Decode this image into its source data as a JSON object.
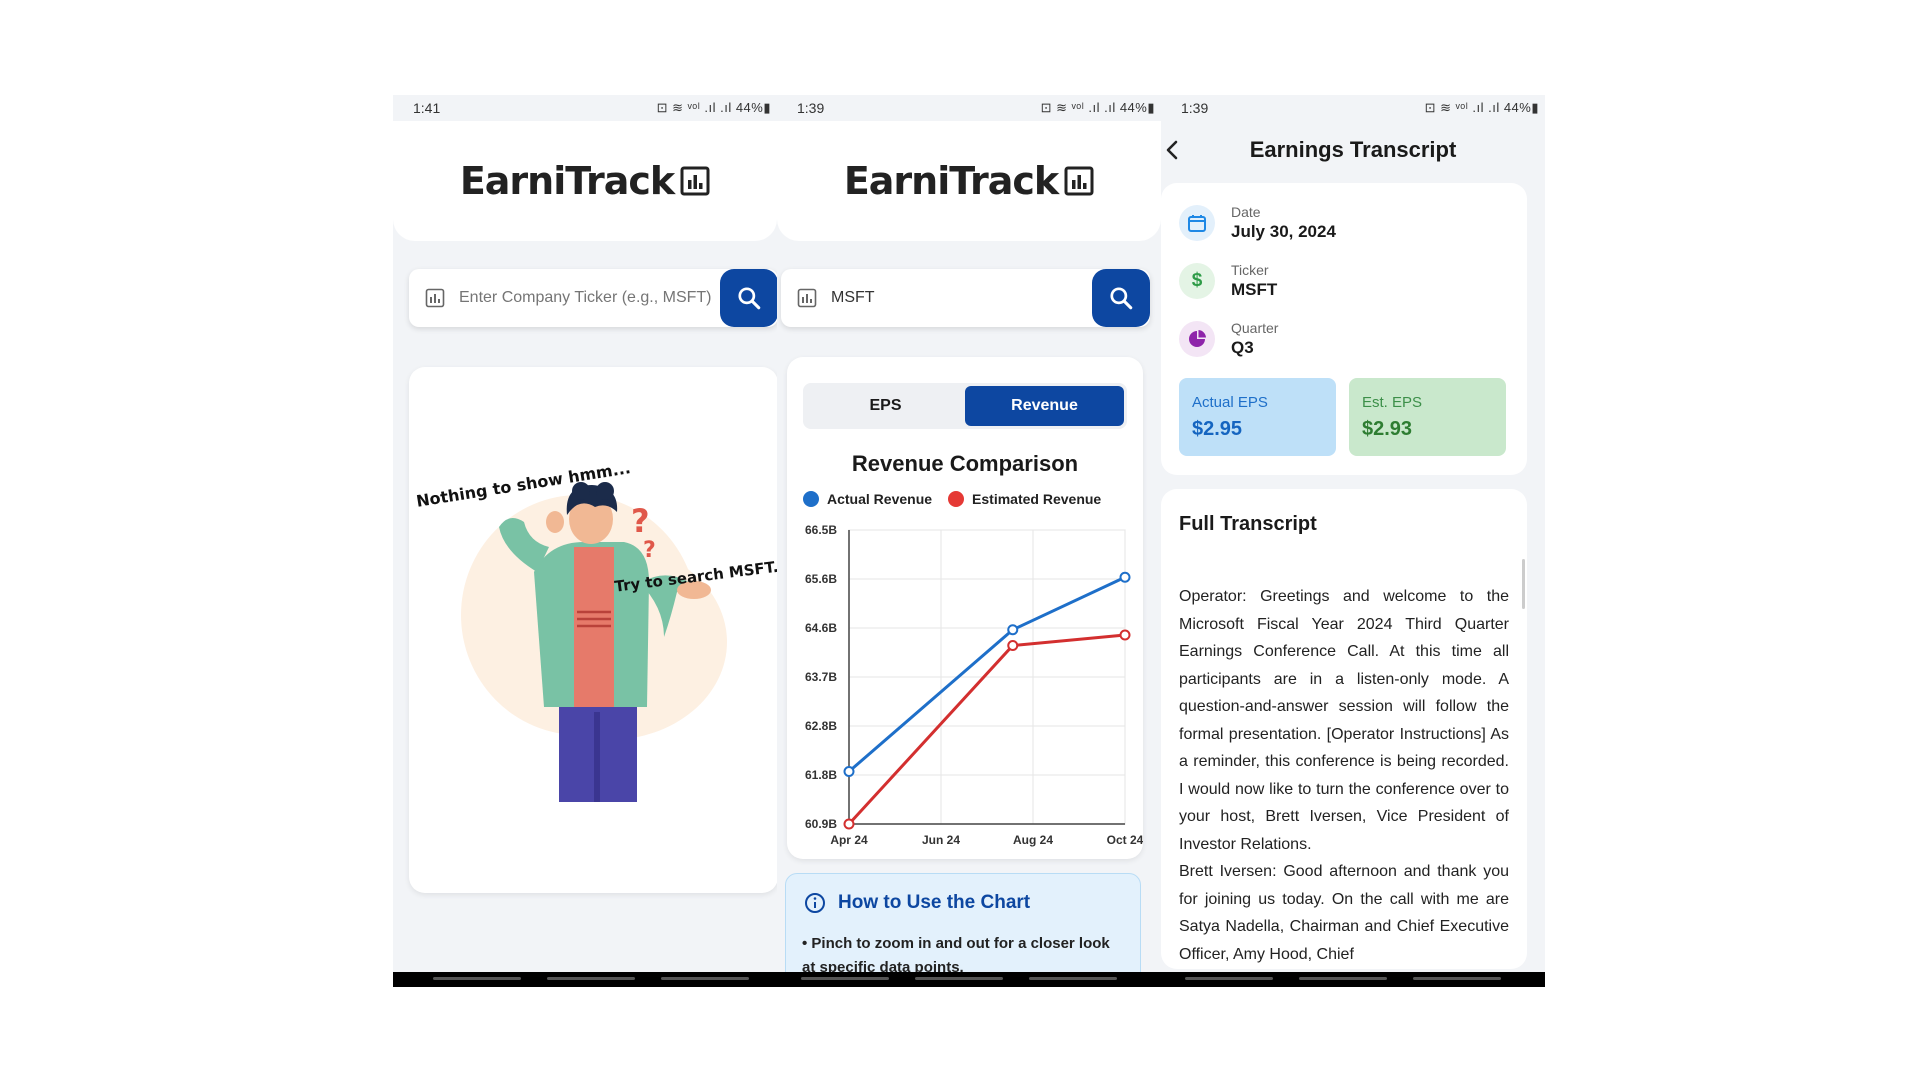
{
  "colors": {
    "primary": "#0d47a1",
    "actual": "#1e6fc9",
    "estimated": "#d32f2f"
  },
  "screen1": {
    "status": {
      "time": "1:41",
      "right": "⊡ ≋ ᵛᵒˡ .ıl .ıl 44%▮"
    },
    "logo": "EarniTrack",
    "search": {
      "placeholder": "Enter Company Ticker (e.g., MSFT)",
      "value": ""
    },
    "empty": {
      "line1": "Nothing to show hmm...",
      "line2": "Try to search MSFT..."
    }
  },
  "screen2": {
    "status": {
      "time": "1:39",
      "right": "⊡ ≋ ᵛᵒˡ .ıl .ıl 44%▮"
    },
    "logo": "EarniTrack",
    "search": {
      "value": "MSFT"
    },
    "tabs": {
      "eps": "EPS",
      "revenue": "Revenue"
    },
    "chart_data": {
      "type": "line",
      "title": "Revenue Comparison",
      "x": [
        "Apr 24",
        "Jun 24",
        "Aug 24",
        "Oct 24"
      ],
      "series": [
        {
          "name": "Actual Revenue",
          "points": [
            [
              0,
              61.9
            ],
            [
              1.78,
              64.6
            ],
            [
              3.0,
              65.6
            ]
          ]
        },
        {
          "name": "Estimated Revenue",
          "points": [
            [
              0,
              60.9
            ],
            [
              1.78,
              64.3
            ],
            [
              3.0,
              64.5
            ]
          ]
        }
      ],
      "yticks": [
        "60.9B",
        "61.8B",
        "62.8B",
        "63.7B",
        "64.6B",
        "65.6B",
        "66.5B"
      ],
      "ylim": [
        60.9,
        66.5
      ],
      "grid": true,
      "legend": "top"
    },
    "howto": {
      "title": "How to Use the Chart",
      "text": "• Pinch to zoom in and out for a closer look at specific data points."
    }
  },
  "screen3": {
    "status": {
      "time": "1:39",
      "right": "⊡ ≋ ᵛᵒˡ .ıl .ıl 44%▮"
    },
    "title": "Earnings Transcript",
    "date": {
      "label": "Date",
      "value": "July 30, 2024"
    },
    "ticker": {
      "label": "Ticker",
      "value": "MSFT"
    },
    "quarter": {
      "label": "Quarter",
      "value": "Q3"
    },
    "actual_eps": {
      "label": "Actual EPS",
      "value": "$2.95"
    },
    "est_eps": {
      "label": "Est. EPS",
      "value": "$2.93"
    },
    "transcript_title": "Full Transcript",
    "transcript": "Operator: Greetings and welcome to the Microsoft Fiscal Year 2024 Third Quarter Earnings Conference Call. At this time all participants are in a listen-only mode. A question-and-answer session will follow the formal presentation. [Operator Instructions] As a reminder, this conference is being recorded. I would now like to turn the conference over to your host, Brett Iversen, Vice President of Investor Relations.\nBrett Iversen: Good afternoon and thank you for joining us today. On the call with me are Satya Nadella, Chairman and Chief Executive Officer, Amy Hood, Chief"
  }
}
